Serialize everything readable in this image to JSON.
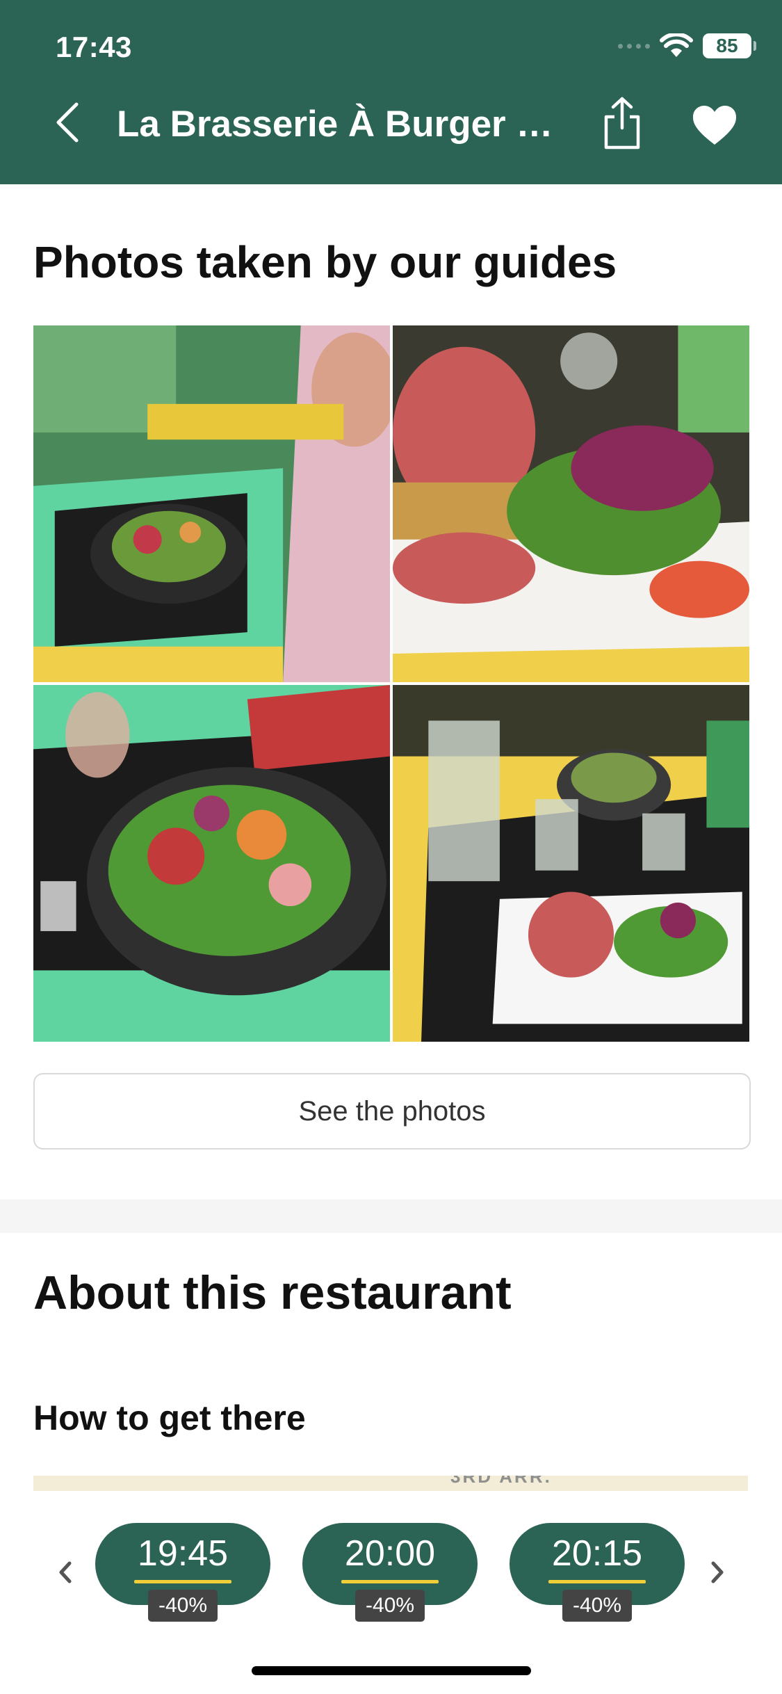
{
  "status_bar": {
    "time": "17:43",
    "battery": "85"
  },
  "nav": {
    "title": "La Brasserie À Burger St...",
    "back_icon": "chevron-left-icon",
    "share_icon": "share-icon",
    "favorite_icon": "heart-icon"
  },
  "photos": {
    "title": "Photos taken by our guides",
    "see_photos_label": "See the photos"
  },
  "about": {
    "title": "About this restaurant",
    "how_to_get_there": "How to get there"
  },
  "map_label": "3RD ARR.",
  "booking": {
    "slots": [
      {
        "time": "19:45",
        "discount": "-40%"
      },
      {
        "time": "20:00",
        "discount": "-40%"
      },
      {
        "time": "20:15",
        "discount": "-40%"
      }
    ]
  },
  "colors": {
    "brand": "#2b6355",
    "accent_underline": "#f2cf38",
    "badge": "#444444"
  }
}
